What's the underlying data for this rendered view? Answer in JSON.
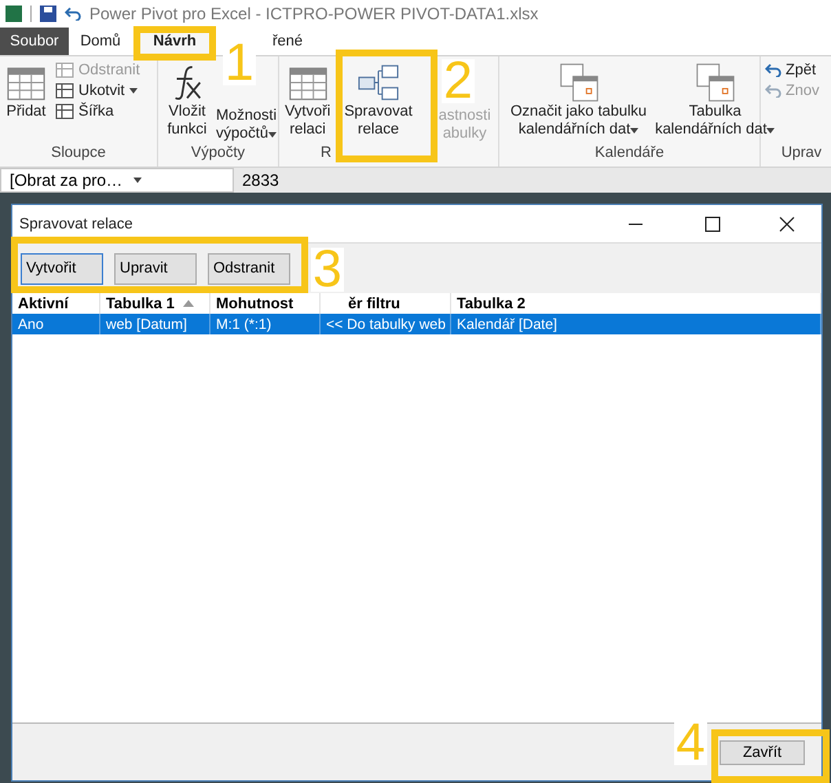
{
  "window": {
    "title": "Power Pivot pro Excel - ICTPRO-POWER PIVOT-DATA1.xlsx"
  },
  "tabs": [
    {
      "label": "Soubor",
      "kind": "file",
      "selected": false
    },
    {
      "label": "Domů",
      "kind": "tab",
      "selected": false
    },
    {
      "label": "Návrh",
      "kind": "tab",
      "selected": true
    },
    {
      "label": "řené",
      "kind": "tab",
      "selected": false
    }
  ],
  "ribbon": {
    "groups": [
      {
        "label": "Sloupce",
        "items": [
          {
            "kind": "large",
            "lines": [
              "Přidat"
            ],
            "dropdown": false,
            "disabled": false
          },
          {
            "kind": "stack",
            "entries": [
              {
                "label": "Odstranit",
                "dropdown": false,
                "disabled": true
              },
              {
                "label": "Ukotvit",
                "dropdown": true,
                "disabled": false
              },
              {
                "label": "Šířka",
                "dropdown": false,
                "disabled": false
              }
            ]
          }
        ]
      },
      {
        "label": "Výpočty",
        "items": [
          {
            "kind": "large",
            "lines": [
              "Vložit",
              "funkci"
            ],
            "dropdown": false,
            "disabled": false
          },
          {
            "kind": "large",
            "lines": [
              "Možnosti",
              "výpočtů"
            ],
            "dropdown": true,
            "disabled": false
          }
        ]
      },
      {
        "label": "R",
        "items": [
          {
            "kind": "large",
            "lines": [
              "Vytvoři",
              "relaci"
            ],
            "dropdown": false,
            "disabled": false
          },
          {
            "kind": "large",
            "lines": [
              "Spravovat",
              "relace"
            ],
            "dropdown": false,
            "disabled": false
          },
          {
            "kind": "large",
            "lines": [
              "astnosti",
              "abulky"
            ],
            "dropdown": false,
            "disabled": true
          }
        ]
      },
      {
        "label": "Kalendáře",
        "items": [
          {
            "kind": "large",
            "lines": [
              "Označit jako tabulku",
              "kalendářních dat"
            ],
            "dropdown": true,
            "disabled": false
          },
          {
            "kind": "large",
            "lines": [
              "Tabulka",
              "kalendářních dat"
            ],
            "dropdown": true,
            "disabled": false
          }
        ]
      },
      {
        "label": "Uprav",
        "items": [
          {
            "kind": "stack",
            "entries": [
              {
                "label": "Zpět",
                "dropdown": false,
                "disabled": false
              },
              {
                "label": "Znov",
                "dropdown": false,
                "disabled": true
              }
            ]
          }
        ]
      }
    ]
  },
  "formula_bar": {
    "name_box": "[Obrat za pro…",
    "value": "2833"
  },
  "dialog": {
    "title": "Spravovat relace",
    "buttons": [
      {
        "label": "Vytvořit",
        "focused": true
      },
      {
        "label": "Upravit",
        "focused": false
      },
      {
        "label": "Odstranit",
        "focused": false
      }
    ],
    "columns": [
      {
        "label": "Aktivní",
        "sorted": false
      },
      {
        "label": "Tabulka 1",
        "sorted": true
      },
      {
        "label": "Mohutnost",
        "sorted": false
      },
      {
        "label": "ěr filtru",
        "sorted": false
      },
      {
        "label": "Tabulka 2",
        "sorted": false
      }
    ],
    "rows": [
      {
        "cells": [
          "Ano",
          "web [Datum]",
          "M:1 (*:1)",
          "<< Do tabulky web",
          "Kalendář [Date]"
        ],
        "selected": true
      }
    ],
    "close_button": "Zavřít"
  },
  "annotations": [
    "1",
    "2",
    "3",
    "4"
  ]
}
